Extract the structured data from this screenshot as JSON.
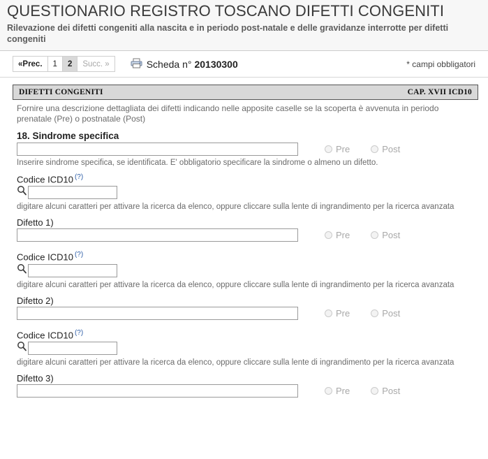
{
  "header": {
    "title": "QUESTIONARIO REGISTRO TOSCANO DIFETTI CONGENITI",
    "subtitle": "Rilevazione dei difetti congeniti alla nascita e in periodo post-natale e delle gravidanze interrotte per difetti congeniti"
  },
  "toolbar": {
    "pager": {
      "prev_label": "«Prec.",
      "page1_label": "1",
      "page2_label": "2",
      "next_label": "Succ. »",
      "current_page": "2"
    },
    "printer_icon": "printer-icon",
    "scheda_label": "Scheda n°",
    "scheda_number": "20130300",
    "required_note": "* campi obbligatori"
  },
  "section": {
    "bar_title": "DIFETTI CONGENITI",
    "bar_right": "CAP. XVII ICD10",
    "description": "Fornire una descrizione dettagliata dei difetti indicando nelle apposite caselle se la scoperta è avvenuta in periodo prenatale (Pre) o postnatale (Post)"
  },
  "labels": {
    "sindrome_specifica": "18. Sindrome specifica",
    "codice_icd10": "Codice ICD10",
    "help_marker": "(?)",
    "difetto_1": "Difetto 1)",
    "difetto_2": "Difetto 2)",
    "difetto_3": "Difetto 3)",
    "pre": "Pre",
    "post": "Post"
  },
  "hints": {
    "sindrome": "Inserire sindrome specifica, se identificata. E' obbligatorio specificare la sindrome o almeno un difetto.",
    "icd10": "digitare alcuni caratteri per attivare la ricerca da elenco, oppure cliccare sulla lente di ingrandimento per la ricerca avanzata"
  },
  "inputs": {
    "sindrome_value": "",
    "icd10_1_value": "",
    "difetto_1_value": "",
    "icd10_2_value": "",
    "difetto_2_value": "",
    "icd10_3_value": "",
    "difetto_3_value": ""
  },
  "colors": {
    "link": "#2f5fa8",
    "section_bar_bg": "#d8d8d8",
    "header_bg": "#f7f7f7"
  }
}
